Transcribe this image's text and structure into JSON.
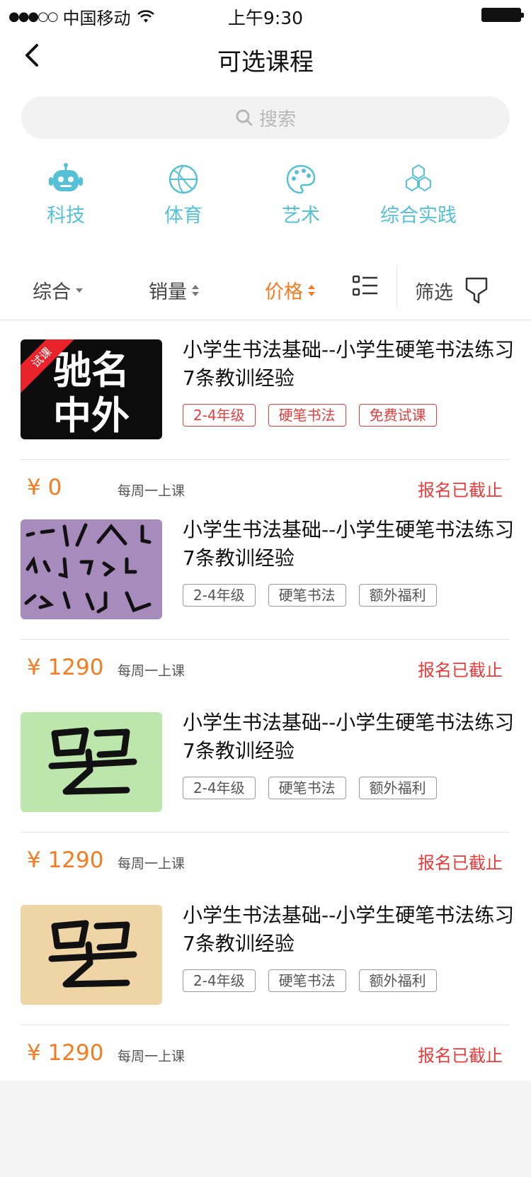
{
  "status_bar": {
    "carrier": "中国移动",
    "time": "上午9:30"
  },
  "nav": {
    "title": "可选课程"
  },
  "search": {
    "placeholder": "搜索"
  },
  "categories": [
    {
      "label": "科技",
      "icon": "robot-icon"
    },
    {
      "label": "体育",
      "icon": "basketball-icon"
    },
    {
      "label": "艺术",
      "icon": "palette-icon"
    },
    {
      "label": "综合实践",
      "icon": "hexagon-cluster-icon"
    }
  ],
  "filters": {
    "comprehensive": "综合",
    "sales": "销量",
    "price": "价格",
    "filter": "筛选"
  },
  "colors": {
    "accent": "#f37b21",
    "category": "#56c0d6",
    "alert": "#ea3a3a"
  },
  "courses": [
    {
      "title": "小学生书法基础--小学生硬笔书法练习7条教训经验",
      "tags": [
        "2-4年级",
        "硬笔书法",
        "免费试课"
      ],
      "ribbon": "试课",
      "thumb_text": [
        "驰名",
        "中外"
      ],
      "price": "¥ 0",
      "schedule": "每周一上课",
      "status": "报名已截止"
    },
    {
      "title": "小学生书法基础--小学生硬笔书法练习7条教训经验",
      "tags": [
        "2-4年级",
        "硬笔书法",
        "额外福利"
      ],
      "price": "¥ 1290",
      "schedule": "每周一上课",
      "status": "报名已截止"
    },
    {
      "title": "小学生书法基础--小学生硬笔书法练习7条教训经验",
      "tags": [
        "2-4年级",
        "硬笔书法",
        "额外福利"
      ],
      "price": "¥ 1290",
      "schedule": "每周一上课",
      "status": "报名已截止"
    },
    {
      "title": "小学生书法基础--小学生硬笔书法练习7条教训经验",
      "tags": [
        "2-4年级",
        "硬笔书法",
        "额外福利"
      ],
      "price": "¥ 1290",
      "schedule": "每周一上课",
      "status": "报名已截止"
    }
  ]
}
